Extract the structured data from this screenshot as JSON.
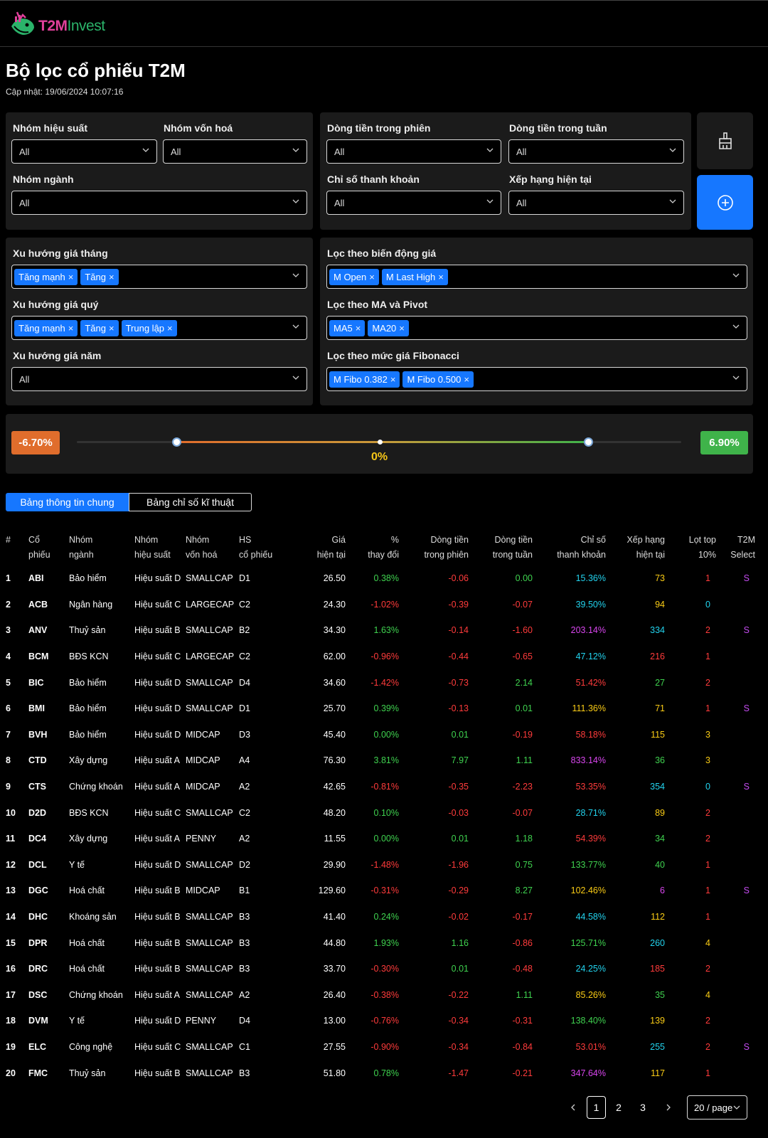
{
  "app": {
    "brand_t2m": "T2M",
    "brand_invest": "Invest"
  },
  "page": {
    "title": "Bộ lọc cổ phiếu T2M",
    "updated": "Cập nhật: 19/06/2024 10:07:16"
  },
  "filters": {
    "nhom_hieu_suat": {
      "label": "Nhóm hiệu suất",
      "value": "All"
    },
    "nhom_von_hoa": {
      "label": "Nhóm vốn hoá",
      "value": "All"
    },
    "nhom_nganh": {
      "label": "Nhóm ngành",
      "value": "All"
    },
    "dong_tien_phien": {
      "label": "Dòng tiền trong phiên",
      "value": "All"
    },
    "dong_tien_tuan": {
      "label": "Dòng tiền trong tuần",
      "value": "All"
    },
    "chi_so_thanh_khoan": {
      "label": "Chỉ số thanh khoản",
      "value": "All"
    },
    "xep_hang": {
      "label": "Xếp hạng hiện tại",
      "value": "All"
    },
    "xu_huong_thang": {
      "label": "Xu hướng giá tháng",
      "tags": [
        "Tăng mạnh",
        "Tăng"
      ]
    },
    "xu_huong_quy": {
      "label": "Xu hướng giá quý",
      "tags": [
        "Tăng mạnh",
        "Tăng",
        "Trung lập"
      ]
    },
    "xu_huong_nam": {
      "label": "Xu hướng giá năm",
      "value": "All"
    },
    "bien_dong_gia": {
      "label": "Lọc theo biến động giá",
      "tags": [
        "M Open",
        "M Last High"
      ]
    },
    "ma_pivot": {
      "label": "Lọc theo MA và Pivot",
      "tags": [
        "MA5",
        "MA20"
      ]
    },
    "fibonacci": {
      "label": "Lọc theo mức giá Fibonacci",
      "tags": [
        "M Fibo 0.382",
        "M Fibo 0.500"
      ]
    }
  },
  "range": {
    "min_label": "-6.70%",
    "max_label": "6.90%",
    "center_label": "0%",
    "low_fraction": 0.17,
    "high_fraction": 0.85
  },
  "tabs": [
    "Bảng thông tin chung",
    "Bảng chỉ số kĩ thuật"
  ],
  "table": {
    "headers": [
      [
        "#",
        ""
      ],
      [
        "Cổ",
        "phiếu"
      ],
      [
        "Nhóm",
        "ngành"
      ],
      [
        "Nhóm",
        "hiệu suất"
      ],
      [
        "Nhóm",
        "vốn hoá"
      ],
      [
        "HS",
        "cổ phiếu"
      ],
      [
        "Giá",
        "hiện tại"
      ],
      [
        "%",
        "thay đổi"
      ],
      [
        "Dòng tiền",
        "trong phiên"
      ],
      [
        "Dòng tiền",
        "trong tuần"
      ],
      [
        "Chỉ số",
        "thanh khoản"
      ],
      [
        "Xếp hạng",
        "hiện tại"
      ],
      [
        "Lọt top",
        "10%"
      ],
      [
        "T2M",
        "Select"
      ]
    ],
    "rows": [
      [
        "1",
        "ABI",
        "Bảo hiểm",
        "Hiệu suất D",
        "SMALLCAP",
        "D1",
        "26.50",
        "0.38%",
        "-0.06",
        "0.00",
        "15.36%",
        "73",
        "1",
        "S"
      ],
      [
        "2",
        "ACB",
        "Ngân hàng",
        "Hiệu suất C",
        "LARGECAP",
        "C2",
        "24.30",
        "-1.02%",
        "-0.39",
        "-0.07",
        "39.50%",
        "94",
        "0",
        ""
      ],
      [
        "3",
        "ANV",
        "Thuỷ sản",
        "Hiệu suất B",
        "SMALLCAP",
        "B2",
        "34.30",
        "1.63%",
        "-0.14",
        "-1.60",
        "203.14%",
        "334",
        "2",
        "S"
      ],
      [
        "4",
        "BCM",
        "BĐS KCN",
        "Hiệu suất C",
        "LARGECAP",
        "C2",
        "62.00",
        "-0.96%",
        "-0.44",
        "-0.65",
        "47.12%",
        "216",
        "1",
        ""
      ],
      [
        "5",
        "BIC",
        "Bảo hiểm",
        "Hiệu suất D",
        "SMALLCAP",
        "D4",
        "34.60",
        "-1.42%",
        "-0.73",
        "2.14",
        "51.42%",
        "27",
        "2",
        ""
      ],
      [
        "6",
        "BMI",
        "Bảo hiểm",
        "Hiệu suất D",
        "SMALLCAP",
        "D1",
        "25.70",
        "0.39%",
        "-0.13",
        "0.01",
        "111.36%",
        "71",
        "1",
        "S"
      ],
      [
        "7",
        "BVH",
        "Bảo hiểm",
        "Hiệu suất D",
        "MIDCAP",
        "D3",
        "45.40",
        "0.00%",
        "0.01",
        "-0.19",
        "58.18%",
        "115",
        "3",
        ""
      ],
      [
        "8",
        "CTD",
        "Xây dựng",
        "Hiệu suất A",
        "MIDCAP",
        "A4",
        "76.30",
        "3.81%",
        "7.97",
        "1.11",
        "833.14%",
        "36",
        "3",
        ""
      ],
      [
        "9",
        "CTS",
        "Chứng khoán",
        "Hiệu suất A",
        "MIDCAP",
        "A2",
        "42.65",
        "-0.81%",
        "-0.35",
        "-2.23",
        "53.35%",
        "354",
        "0",
        "S"
      ],
      [
        "10",
        "D2D",
        "BĐS KCN",
        "Hiệu suất C",
        "SMALLCAP",
        "C2",
        "48.20",
        "0.10%",
        "-0.03",
        "-0.07",
        "28.71%",
        "89",
        "2",
        ""
      ],
      [
        "11",
        "DC4",
        "Xây dựng",
        "Hiệu suất A",
        "PENNY",
        "A2",
        "11.55",
        "0.00%",
        "0.01",
        "1.18",
        "54.39%",
        "34",
        "2",
        ""
      ],
      [
        "12",
        "DCL",
        "Y tế",
        "Hiệu suất D",
        "SMALLCAP",
        "D2",
        "29.90",
        "-1.48%",
        "-1.96",
        "0.75",
        "133.77%",
        "40",
        "1",
        ""
      ],
      [
        "13",
        "DGC",
        "Hoá chất",
        "Hiệu suất B",
        "MIDCAP",
        "B1",
        "129.60",
        "-0.31%",
        "-0.29",
        "8.27",
        "102.46%",
        "6",
        "1",
        "S"
      ],
      [
        "14",
        "DHC",
        "Khoáng sản",
        "Hiệu suất B",
        "SMALLCAP",
        "B3",
        "41.40",
        "0.24%",
        "-0.02",
        "-0.17",
        "44.58%",
        "112",
        "1",
        ""
      ],
      [
        "15",
        "DPR",
        "Hoá chất",
        "Hiệu suất B",
        "SMALLCAP",
        "B3",
        "44.80",
        "1.93%",
        "1.16",
        "-0.86",
        "125.71%",
        "260",
        "4",
        ""
      ],
      [
        "16",
        "DRC",
        "Hoá chất",
        "Hiệu suất B",
        "SMALLCAP",
        "B3",
        "33.70",
        "-0.30%",
        "0.01",
        "-0.48",
        "24.25%",
        "185",
        "2",
        ""
      ],
      [
        "17",
        "DSC",
        "Chứng khoán",
        "Hiệu suất A",
        "SMALLCAP",
        "A2",
        "26.40",
        "-0.38%",
        "-0.22",
        "1.11",
        "85.26%",
        "35",
        "4",
        ""
      ],
      [
        "18",
        "DVM",
        "Y tế",
        "Hiệu suất D",
        "PENNY",
        "D4",
        "13.00",
        "-0.76%",
        "-0.34",
        "-0.31",
        "138.40%",
        "139",
        "2",
        ""
      ],
      [
        "19",
        "ELC",
        "Công nghệ",
        "Hiệu suất C",
        "SMALLCAP",
        "C1",
        "27.55",
        "-0.90%",
        "-0.34",
        "-0.84",
        "53.01%",
        "255",
        "2",
        "S"
      ],
      [
        "20",
        "FMC",
        "Thuỷ sản",
        "Hiệu suất B",
        "SMALLCAP",
        "B3",
        "51.80",
        "0.78%",
        "-1.47",
        "-0.21",
        "347.64%",
        "117",
        "1",
        ""
      ]
    ],
    "colors": {
      "liquidity": [
        "cy",
        "cy",
        "mg",
        "cy",
        "red",
        "yl",
        "red",
        "mg",
        "red",
        "cy",
        "red",
        "g",
        "yl",
        "cy",
        "g",
        "cy",
        "yl",
        "g",
        "red",
        "mg"
      ],
      "rank": [
        "yl",
        "yl",
        "cy",
        "red",
        "g",
        "yl",
        "yl",
        "g",
        "cy",
        "yl",
        "g",
        "g",
        "mg",
        "yl",
        "cy",
        "red",
        "g",
        "yl",
        "cy",
        "yl"
      ],
      "top": [
        "red",
        "cy",
        "red",
        "red",
        "red",
        "red",
        "yl",
        "yl",
        "cy",
        "red",
        "red",
        "red",
        "red",
        "red",
        "yl",
        "red",
        "yl",
        "red",
        "red",
        "red"
      ]
    }
  },
  "pagination": {
    "pages": [
      "1",
      "2",
      "3"
    ],
    "current": "1",
    "page_size": "20 / page"
  }
}
